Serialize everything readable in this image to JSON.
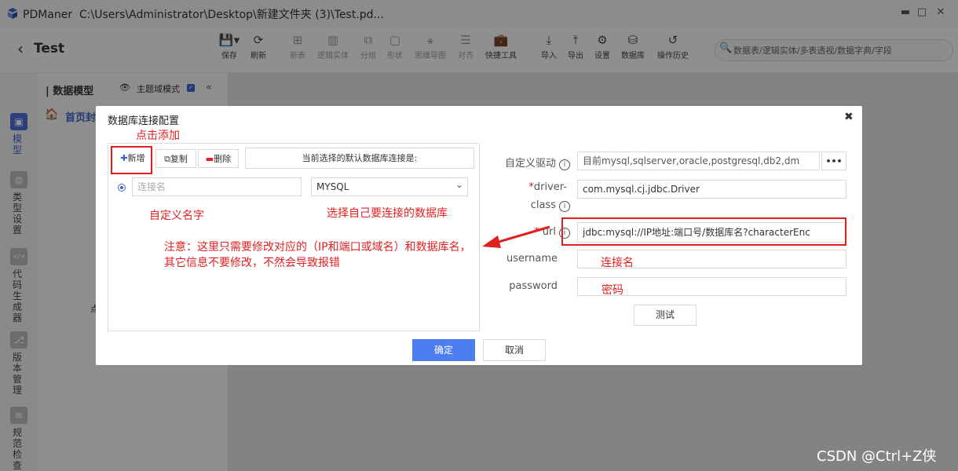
{
  "window": {
    "app_name": "PDManer",
    "path": "C:\\Users\\Administrator\\Desktop\\新建文件夹 (3)\\Test.pd...",
    "minimize": "▬",
    "maximize": "□",
    "close": "✕"
  },
  "project": {
    "title": "Test",
    "back": "‹"
  },
  "toolbar": {
    "tools": [
      {
        "icon": "💾▾",
        "label": "保存"
      },
      {
        "icon": "⟳",
        "label": "刷新"
      },
      {
        "icon": "⊞",
        "label": "新表"
      },
      {
        "icon": "▥",
        "label": "逻辑实体"
      },
      {
        "icon": "⧉",
        "label": "分组"
      },
      {
        "icon": "▢",
        "label": "形状"
      },
      {
        "icon": "⚹",
        "label": "思维导图"
      },
      {
        "icon": "☰",
        "label": "对齐"
      },
      {
        "icon": "💼",
        "label": "快捷工具"
      },
      {
        "icon": "⤓",
        "label": "导入"
      },
      {
        "icon": "⤒",
        "label": "导出"
      },
      {
        "icon": "⚙",
        "label": "设置"
      },
      {
        "icon": "⛁",
        "label": "数据库"
      },
      {
        "icon": "↺",
        "label": "操作历史"
      }
    ],
    "search_icon": "🔍",
    "search_placeholder": "数据表/逻辑实体/多表透视/数据字典/字段"
  },
  "rail": {
    "items": [
      {
        "icon": "▣",
        "label": "模型"
      },
      {
        "icon": "◍",
        "label": "类型设置"
      },
      {
        "icon": "</>",
        "label": "代码生成器"
      },
      {
        "icon": "⎇",
        "label": "版本管理"
      },
      {
        "icon": "≡",
        "label": "规范检查"
      }
    ]
  },
  "side": {
    "title": "| 数据模型",
    "eye": "👁",
    "domain_mode": "主题域模式",
    "checkbox": "✓",
    "collapse": "«",
    "home_icon": "🏠",
    "home": "首页封",
    "misc": "点"
  },
  "modal": {
    "title": "数据库连接配置",
    "close": "✖",
    "add": "新增",
    "add_icon": "✚",
    "copy": "复制",
    "copy_icon": "⧉",
    "delete": "删除",
    "delete_icon": "▬",
    "current_default": "当前选择的默认数据库连接是:",
    "conn_name_placeholder": "连接名",
    "db_type": "MYSQL",
    "db_type_arrow": "⌄",
    "custom_driver_label": "自定义驱动",
    "custom_driver_value": "目前mysql,sqlserver,oracle,postgresql,db2,dm",
    "more": "•••",
    "driver_class_label_1": "driver-",
    "driver_class_label_2": "class",
    "driver_class_value": "com.mysql.cj.jdbc.Driver",
    "url_label": "url",
    "url_value": "jdbc:mysql://IP地址:端口号/数据库名?characterEnc",
    "username_label": "username",
    "password_label": "password",
    "test": "测试",
    "ok": "确定",
    "cancel": "取消",
    "info": "i",
    "required": "*"
  },
  "annotations": {
    "click_add": "点击添加",
    "custom_name": "自定义名字",
    "choose_db": "选择自己要连接的数据库",
    "note_line1": "注意：这里只需要修改对应的（IP和端口或域名）和数据库名，",
    "note_line2": "其它信息不要修改，不然会导致报错",
    "conn_name": "连接名",
    "password": "密码",
    "arrow_color": "#e02020"
  },
  "watermark": "CSDN @Ctrl+Z侠"
}
